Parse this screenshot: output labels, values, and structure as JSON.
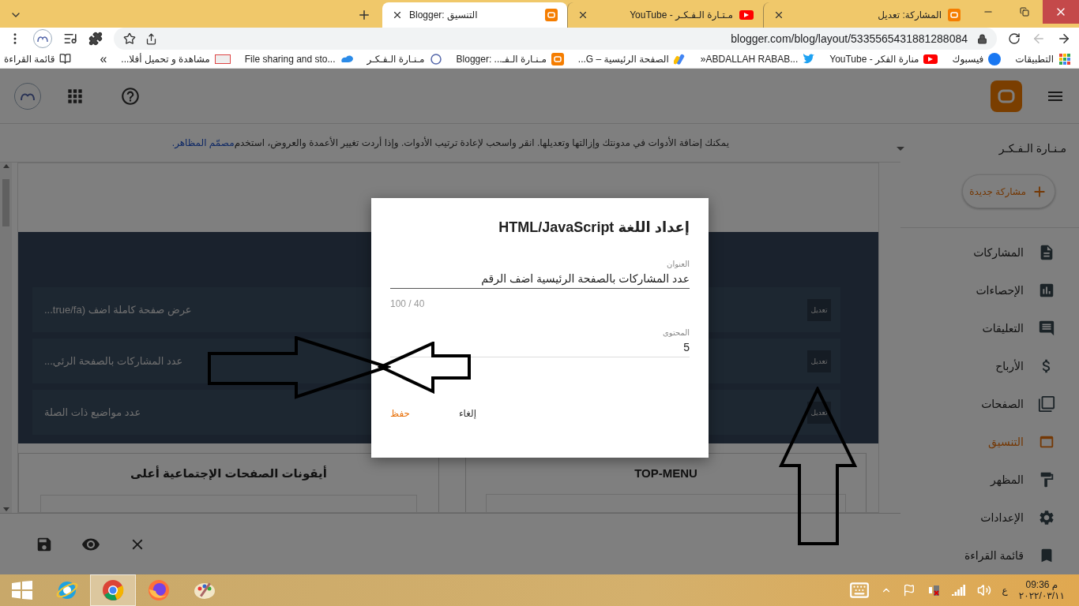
{
  "browser": {
    "tabs": [
      {
        "title": "المشاركة: تعديل",
        "selected": false
      },
      {
        "title": "مـتـارة الـفـكـر - YouTube",
        "selected": false
      },
      {
        "title": "Blogger: التنسيق",
        "selected": true
      }
    ],
    "address": "blogger.com/blog/layout/5335565431881288084",
    "bookmarks": [
      "التطبيقات",
      "فيسبوك",
      "منارة الفكر - YouTube",
      "»ABDALLAH RABAB...",
      "الصفحة الرئيسية – G...",
      "مـنـارة الـفـ... :Blogger",
      "مـنـارة الـفـكـر",
      "File sharing and sto...",
      "مشاهدة و تحميل أفلا..."
    ],
    "more": "»",
    "reading_list": "قائمة القراءة"
  },
  "blogger": {
    "info": {
      "text": "يمكنك إضافة الأدوات في مدونتك وإزالتها وتعديلها. انقر واسحب لإعادة ترتيب الأدوات. وإذا أردت تغيير الأعمدة والعروض، استخدم ",
      "link": "مصمّم المظاهر."
    },
    "widgets": [
      {
        "title": "عرض صفحة كاملة اضف (true/fa...",
        "edit": "تعديل"
      },
      {
        "title": "عدد المشاركات بالصفحة الرئي...",
        "edit": "تعديل"
      },
      {
        "title": "عدد مواضيع ذات الصلة",
        "edit": "تعديل"
      }
    ],
    "cards": [
      "TOP-MENU",
      "أيقونات الصفحات الإجتماعية أعلى"
    ],
    "sidebar": {
      "blog_name": "مـنـارة الـفـكـر",
      "new_post": "مشاركة جديدة",
      "items": [
        {
          "label": "المشاركات",
          "selected": false
        },
        {
          "label": "الإحصاءات",
          "selected": false
        },
        {
          "label": "التعليقات",
          "selected": false
        },
        {
          "label": "الأرباح",
          "selected": false
        },
        {
          "label": "الصفحات",
          "selected": false
        },
        {
          "label": "التنسيق",
          "selected": true
        },
        {
          "label": "المظهر",
          "selected": false
        },
        {
          "label": "الإعدادات",
          "selected": false
        },
        {
          "label": "قائمة القراءة",
          "selected": false
        }
      ]
    }
  },
  "dialog": {
    "title": "إعداد اللغة HTML/JavaScript",
    "title_label": "العنوان",
    "title_value": "عدد المشاركات بالصفحة الرئيسية اضف الرقم",
    "counter": "100 / 40",
    "content_label": "المحتوى",
    "content_value": "5",
    "save": "حفظ",
    "cancel": "إلغاء"
  },
  "taskbar": {
    "apps": [
      {
        "active": false
      },
      {
        "active": true
      },
      {
        "active": false
      },
      {
        "active": false
      }
    ],
    "language": "ع",
    "time": "م 09:36",
    "date": "٢٠٢٢/٠٣/١١"
  }
}
